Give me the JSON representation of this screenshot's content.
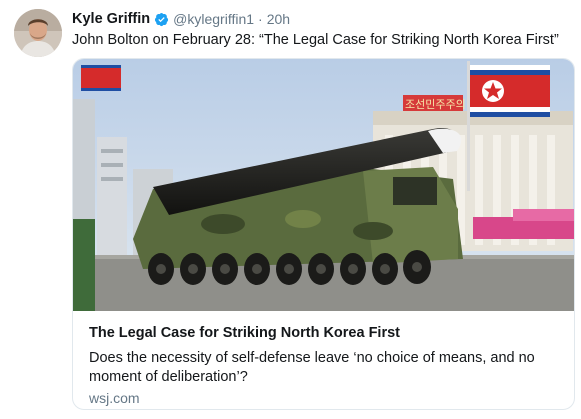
{
  "tweet": {
    "display_name": "Kyle Griffin",
    "handle": "@kylegriffin1",
    "separator": "·",
    "time": "20h",
    "text": "John Bolton on February 28: “The Legal Case for Striking North Korea First”",
    "verified": true
  },
  "card": {
    "title": "The Legal Case for Striking North Korea First",
    "description": "Does the necessity of self-defense leave ‘no choice of means, and no moment of deliberation’?",
    "domain": "wsj.com",
    "banner_text": "조선민주주의"
  },
  "colors": {
    "verified_blue": "#1da1f2",
    "secondary_text": "#657786",
    "border": "#e1e8ed",
    "missile_green": "#4f5f37"
  },
  "icons": {
    "verified": "verified-badge-icon"
  }
}
